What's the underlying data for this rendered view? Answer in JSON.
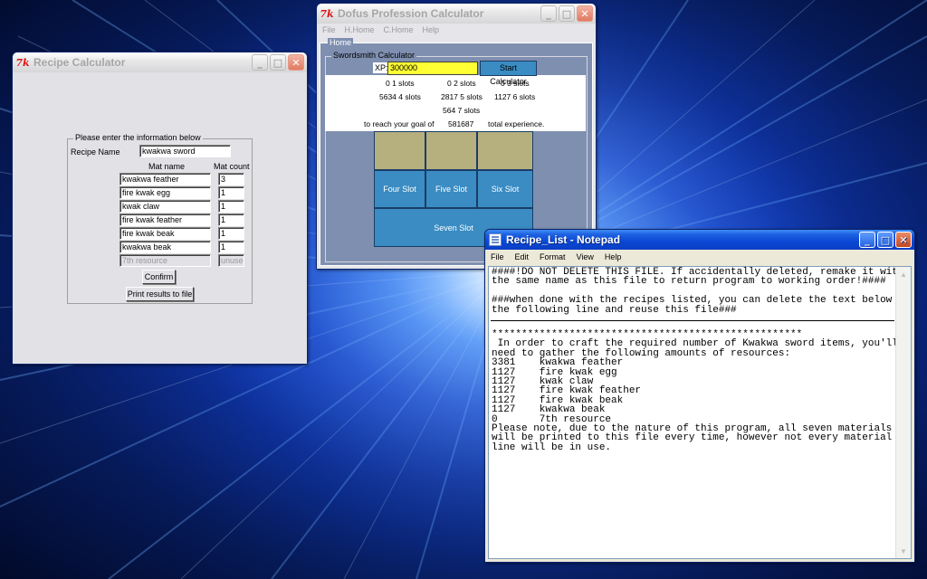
{
  "recipe_window": {
    "title": "Recipe Calculator",
    "group_label": "Please enter the information below",
    "recipe_name_label": "Recipe Name",
    "recipe_name_value": "kwakwa sword",
    "mat_name_header": "Mat name",
    "mat_count_header": "Mat count",
    "materials": [
      {
        "name": "kwakwa feather",
        "count": "3",
        "enabled": true
      },
      {
        "name": "fire kwak egg",
        "count": "1",
        "enabled": true
      },
      {
        "name": "kwak claw",
        "count": "1",
        "enabled": true
      },
      {
        "name": "fire kwak feather",
        "count": "1",
        "enabled": true
      },
      {
        "name": "fire kwak beak",
        "count": "1",
        "enabled": true
      },
      {
        "name": "kwakwa beak",
        "count": "1",
        "enabled": true
      },
      {
        "name": "7th resource",
        "count": "unused",
        "enabled": false
      }
    ],
    "confirm_label": "Confirm",
    "print_label": "Print results to file"
  },
  "dofus_window": {
    "title": "Dofus Profession Calculator",
    "menu": [
      "File",
      "H.Home",
      "C.Home",
      "Help"
    ],
    "home_label": "Home",
    "calc_label": "Swordsmith Calculator",
    "xp_label": "XP:",
    "xp_value": "300000",
    "start_label": "Start Calculator",
    "stats": {
      "s1": "0 1 slots",
      "s2": "0 2 slots",
      "s3": "0 3 slots",
      "s4": "5634 4 slots",
      "s5": "2817 5 slots",
      "s6": "1127 6 slots",
      "s7": "564 7 slots",
      "goal_prefix": "to reach your goal of",
      "goal_value": "581687",
      "goal_suffix": "total experience."
    },
    "slot_buttons": {
      "four": "Four Slot",
      "five": "Five Slot",
      "six": "Six Slot",
      "seven": "Seven Slot"
    }
  },
  "notepad_window": {
    "title": "Recipe_List - Notepad",
    "menu": [
      "File",
      "Edit",
      "Format",
      "View",
      "Help"
    ],
    "header_text": "####!DO NOT DELETE THIS FILE. If accidentally deleted, remake it with\nthe same name as this file to return program to working order!####\n\n###when done with the recipes listed, you can delete the text below\nthe following line and reuse this file###",
    "body_text": "****************************************************\n In order to craft the required number of Kwakwa sword items, you'll\nneed to gather the following amounts of resources:\n3381    kwakwa feather\n1127    fire kwak egg\n1127    kwak claw\n1127    fire kwak feather\n1127    fire kwak beak\n1127    kwakwa beak\n0       7th resource\nPlease note, due to the nature of this program, all seven materials\nwill be printed to this file every time, however not every material\nline will be in use."
  }
}
